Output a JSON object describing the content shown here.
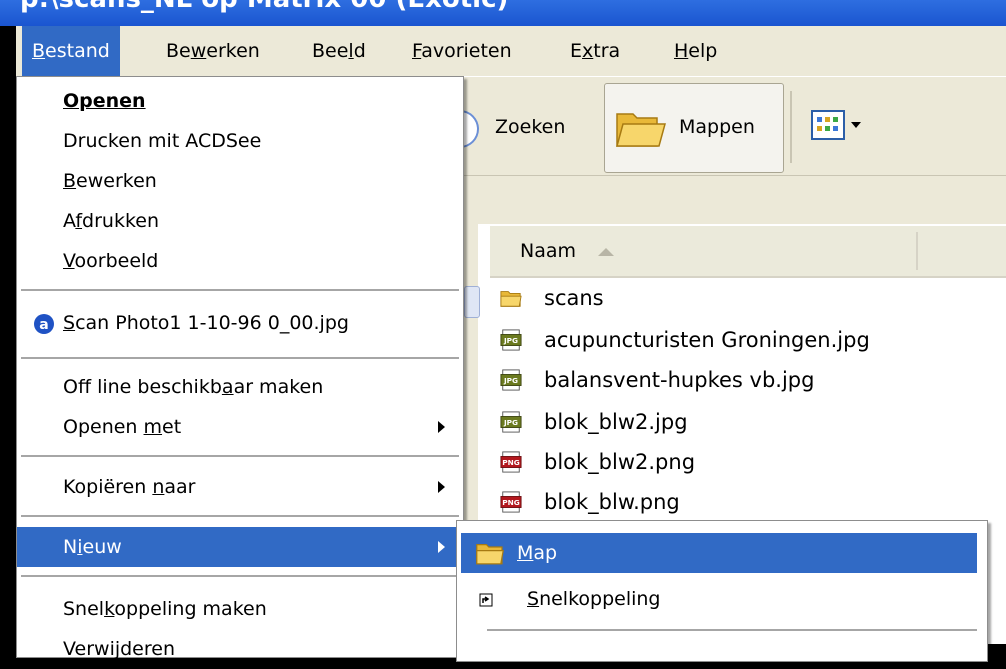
{
  "window": {
    "title": "p:\\scans_NL op Matrix 00 (Exotic)"
  },
  "menubar": [
    {
      "pre": "",
      "u": "B",
      "post": "estand"
    },
    {
      "pre": "Be",
      "u": "w",
      "post": "erken"
    },
    {
      "pre": "Bee",
      "u": "l",
      "post": "d"
    },
    {
      "pre": "",
      "u": "F",
      "post": "avorieten"
    },
    {
      "pre": "E",
      "u": "x",
      "post": "tra"
    },
    {
      "pre": "",
      "u": "H",
      "post": "elp"
    }
  ],
  "toolbar": {
    "search_label": "Zoeken",
    "folders_label": "Mappen"
  },
  "columns": {
    "name_header": "Naam"
  },
  "files": [
    {
      "name": "scans",
      "type": "folder"
    },
    {
      "name": "acupuncturisten Groningen.jpg",
      "type": "jpg"
    },
    {
      "name": "balansvent-hupkes vb.jpg",
      "type": "jpg"
    },
    {
      "name": "blok_blw2.jpg",
      "type": "jpg"
    },
    {
      "name": "blok_blw2.png",
      "type": "png"
    },
    {
      "name": "blok_blw.png",
      "type": "png"
    }
  ],
  "file_menu": {
    "open": {
      "pre": "",
      "u": "",
      "post": "Openen"
    },
    "print_acdsee": {
      "pre": "Drucken mit ACDSee",
      "u": "",
      "post": ""
    },
    "edit": {
      "pre": "",
      "u": "B",
      "post": "ewerken"
    },
    "print": {
      "pre": "A",
      "u": "f",
      "post": "drukken"
    },
    "preview": {
      "pre": "",
      "u": "V",
      "post": "oorbeeld"
    },
    "recent": {
      "pre": "",
      "u": "S",
      "post": "can Photo1 1-10-96 0_00.jpg"
    },
    "offline": {
      "pre": "Off line beschikb",
      "u": "a",
      "post": "ar maken"
    },
    "open_with": {
      "pre": "Openen ",
      "u": "m",
      "post": "et"
    },
    "copy_to": {
      "pre": "Kopiëren ",
      "u": "n",
      "post": "aar"
    },
    "new": {
      "pre": "N",
      "u": "i",
      "post": "euw"
    },
    "shortcut": {
      "pre": "Snel",
      "u": "k",
      "post": "oppeling maken"
    },
    "delete": {
      "pre": "Verwijderen",
      "u": "",
      "post": ""
    }
  },
  "new_submenu": {
    "folder": {
      "pre": "",
      "u": "M",
      "post": "ap"
    },
    "shortcut": {
      "pre": "",
      "u": "S",
      "post": "nelkoppeling"
    }
  },
  "colors": {
    "highlight": "#316ac5",
    "menu_bg": "#ffffff",
    "chrome": "#ece9d8"
  }
}
